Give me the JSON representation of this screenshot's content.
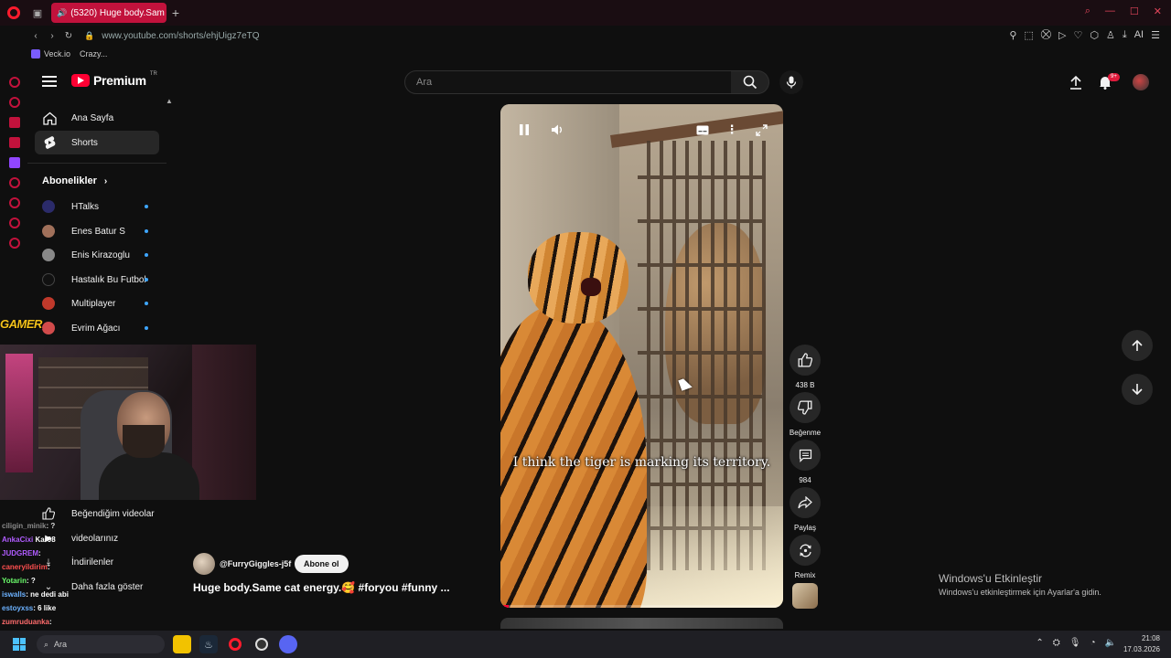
{
  "browser": {
    "tab_title": "(5320) Huge body.Sam",
    "url": "www.youtube.com/shorts/ehjUigz7eTQ",
    "bookmarks": [
      "Veck.io",
      "Crazy..."
    ]
  },
  "header": {
    "logo_text": "Premium",
    "logo_country": "TR",
    "search_placeholder": "Ara",
    "notification_count": "9+"
  },
  "sidebar": {
    "items": [
      {
        "label": "Ana Sayfa",
        "icon": "home-icon"
      },
      {
        "label": "Shorts",
        "icon": "shorts-icon"
      }
    ],
    "subscriptions_heading": "Abonelikler",
    "subscriptions": [
      {
        "label": "HTalks",
        "color": "#2b2b6a"
      },
      {
        "label": "Enes Batur S",
        "color": "#a0705a"
      },
      {
        "label": "Enis Kirazoglu",
        "color": "#888888"
      },
      {
        "label": "Hastalık Bu Futbol",
        "color": "#111111"
      },
      {
        "label": "Multiplayer",
        "color": "#c0392b"
      },
      {
        "label": "Evrim Ağacı",
        "color": "#d14b4b"
      }
    ],
    "lower_items": [
      {
        "label": "Beğendiğim videolar",
        "icon": "thumbs-up-icon"
      },
      {
        "label": "videolarınız",
        "icon": "video-icon"
      },
      {
        "label": "İndirilenler",
        "icon": "download-icon"
      },
      {
        "label": "Daha fazla göster",
        "icon": "chevron-down-icon"
      }
    ]
  },
  "stream_overlay": {
    "logo_text": "GAMER",
    "chat": [
      {
        "user": "ciligin_minik",
        "msg": ": ?",
        "color": "#8a8a8a"
      },
      {
        "user": "AnkaCixi",
        "msg": "Kar98",
        "color": "#b05cff"
      },
      {
        "user": "JUDGREM",
        "msg": ":",
        "color": "#b05cff"
      },
      {
        "user": "caneryildirim",
        "msg": ":",
        "color": "#ff4f4f"
      },
      {
        "user": "Yotarin",
        "msg": ": ?",
        "color": "#6cff6c"
      },
      {
        "user": "iswalls",
        "msg": ": ne dedi abi",
        "color": "#6cb2ff"
      },
      {
        "user": "estoyxss",
        "msg": ": 6 like",
        "color": "#6cb2ff"
      },
      {
        "user": "zumruduanka",
        "msg": ":",
        "color": "#ff6c6c"
      }
    ]
  },
  "video": {
    "subtitle": "I think the tiger is marking its territory.",
    "progress": 0.03,
    "channel": "@FurryGiggles-j5f",
    "subscribe_label": "Abone ol",
    "title": "Huge body.Same cat energy.🥰 #foryou #funny ..."
  },
  "actions": {
    "like_count": "438 B",
    "dislike_label": "Beğenme",
    "comment_count": "984",
    "share_label": "Paylaş",
    "remix_label": "Remix"
  },
  "windows_activation": {
    "line1": "Windows'u Etkinleştir",
    "line2": "Windows'u etkinleştirmek için Ayarlar'a gidin."
  },
  "taskbar": {
    "search_placeholder": "Ara",
    "time": "21:08",
    "date": "17.03.2026"
  }
}
